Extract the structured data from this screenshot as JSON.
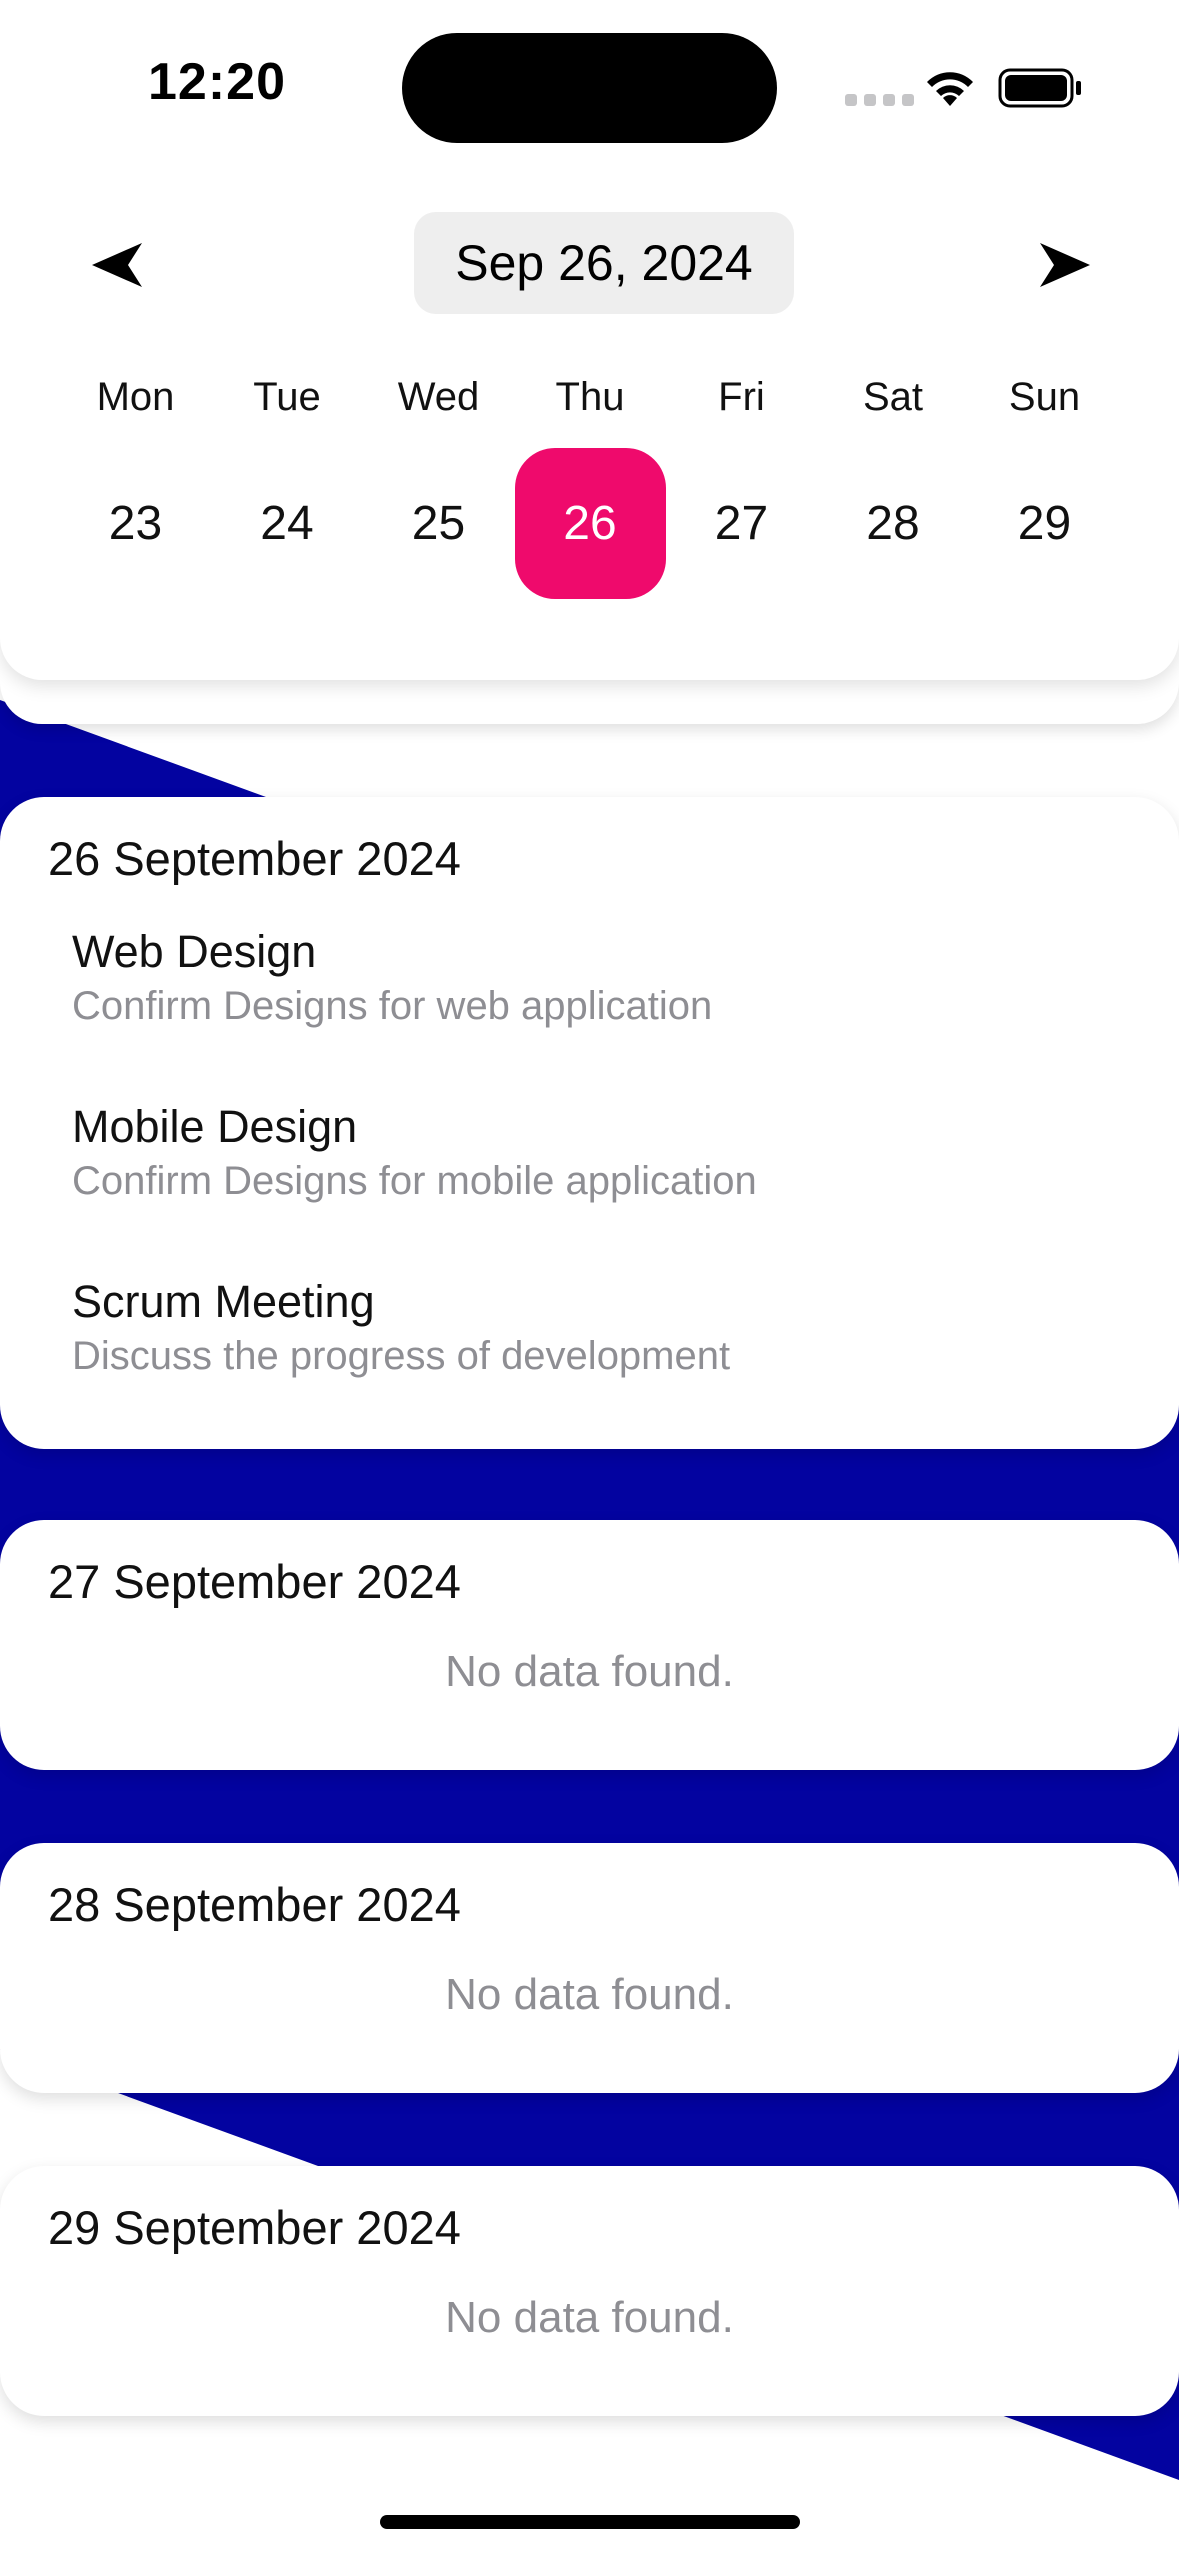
{
  "status_bar": {
    "time": "12:20"
  },
  "calendar": {
    "current_date": "Sep 26, 2024",
    "weekdays": [
      "Mon",
      "Tue",
      "Wed",
      "Thu",
      "Fri",
      "Sat",
      "Sun"
    ],
    "days": [
      "23",
      "24",
      "25",
      "26",
      "27",
      "28",
      "29"
    ],
    "selected_day": "26",
    "selected_color": "#ef0a6c"
  },
  "background_accent": "#0303a0",
  "cards": [
    {
      "date": "26 September 2024",
      "events": [
        {
          "title": "Web Design",
          "description": "Confirm Designs for web application"
        },
        {
          "title": "Mobile Design",
          "description": "Confirm Designs for mobile application"
        },
        {
          "title": "Scrum Meeting",
          "description": "Discuss the progress of development"
        }
      ]
    },
    {
      "date": "27 September 2024",
      "empty_text": "No data found."
    },
    {
      "date": "28 September 2024",
      "empty_text": "No data found."
    },
    {
      "date": "29 September 2024",
      "empty_text": "No data found."
    }
  ]
}
